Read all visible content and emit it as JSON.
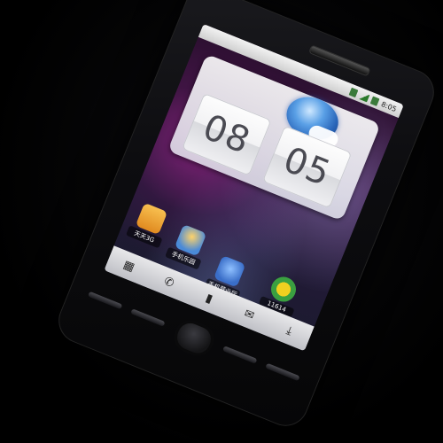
{
  "statusbar": {
    "time": "8:05"
  },
  "clock_widget": {
    "hour": "08",
    "minute": "05"
  },
  "dock": {
    "apps": [
      {
        "label": "天天3G",
        "color": "#f0a030",
        "icon": "mail-icon"
      },
      {
        "label": "手机乐园",
        "color": "#4a8ad8",
        "icon": "games-icon"
      },
      {
        "label": "手机营业厅",
        "color": "#3a6ec8",
        "icon": "contacts-icon"
      },
      {
        "label": "11614",
        "color": "#3aa040",
        "icon": "arrow-icon"
      }
    ]
  },
  "bottombar": {
    "icons": [
      "grid-icon",
      "phone-icon",
      "contacts-book-icon",
      "messages-icon",
      "download-icon"
    ]
  },
  "colors": {
    "screen_bg": "#3a1740",
    "accent": "#5aa0e6"
  }
}
